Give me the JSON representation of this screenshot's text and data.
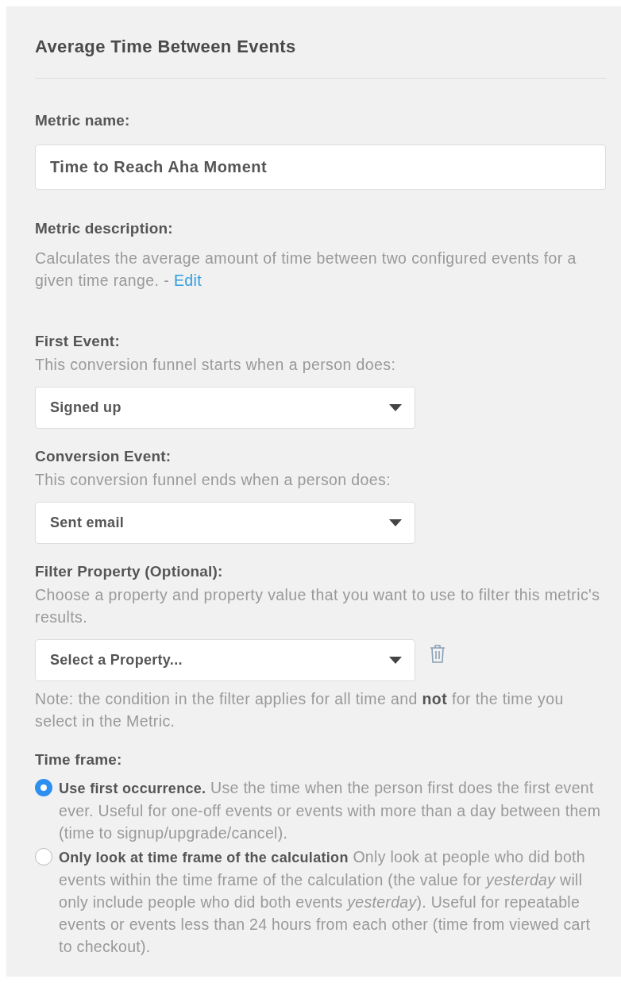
{
  "title": "Average Time Between Events",
  "metric_name": {
    "label": "Metric name:",
    "value": "Time to Reach Aha Moment"
  },
  "metric_description": {
    "label": "Metric description:",
    "text": "Calculates the average amount of time between two configured events for a given time range. -",
    "link": "Edit"
  },
  "events": [
    {
      "label": "First Event:",
      "hint": "This conversion funnel starts when a person does:",
      "value": "Signed up"
    },
    {
      "label": "Conversion Event:",
      "hint": "This conversion funnel ends when a person does:",
      "value": "Sent email"
    }
  ],
  "filter": {
    "label": "Filter Property (Optional):",
    "hint": "Choose a property and property value that you want to use to filter this metric's results.",
    "value": "Select a Property...",
    "note": "Note: the condition in the filter applies for all time and **not** for the time you select in the Metric."
  },
  "time_frame": {
    "label": "Time frame:",
    "options": [
      {
        "text": "**Use first occurrence.** Use the time when the person first does the first event ever. Useful for one-off events or events with more than a day between them (time to signup/upgrade/cancel).",
        "selected": true
      },
      {
        "text": "**Only look at time frame of the calculation** Only look at people who did both events within the time frame of the calculation (the value for *yesterday* will only include people who did both events *yesterday*). Useful for repeatable events or events less than 24 hours from each other (time from viewed cart to checkout).",
        "selected": false
      }
    ]
  }
}
